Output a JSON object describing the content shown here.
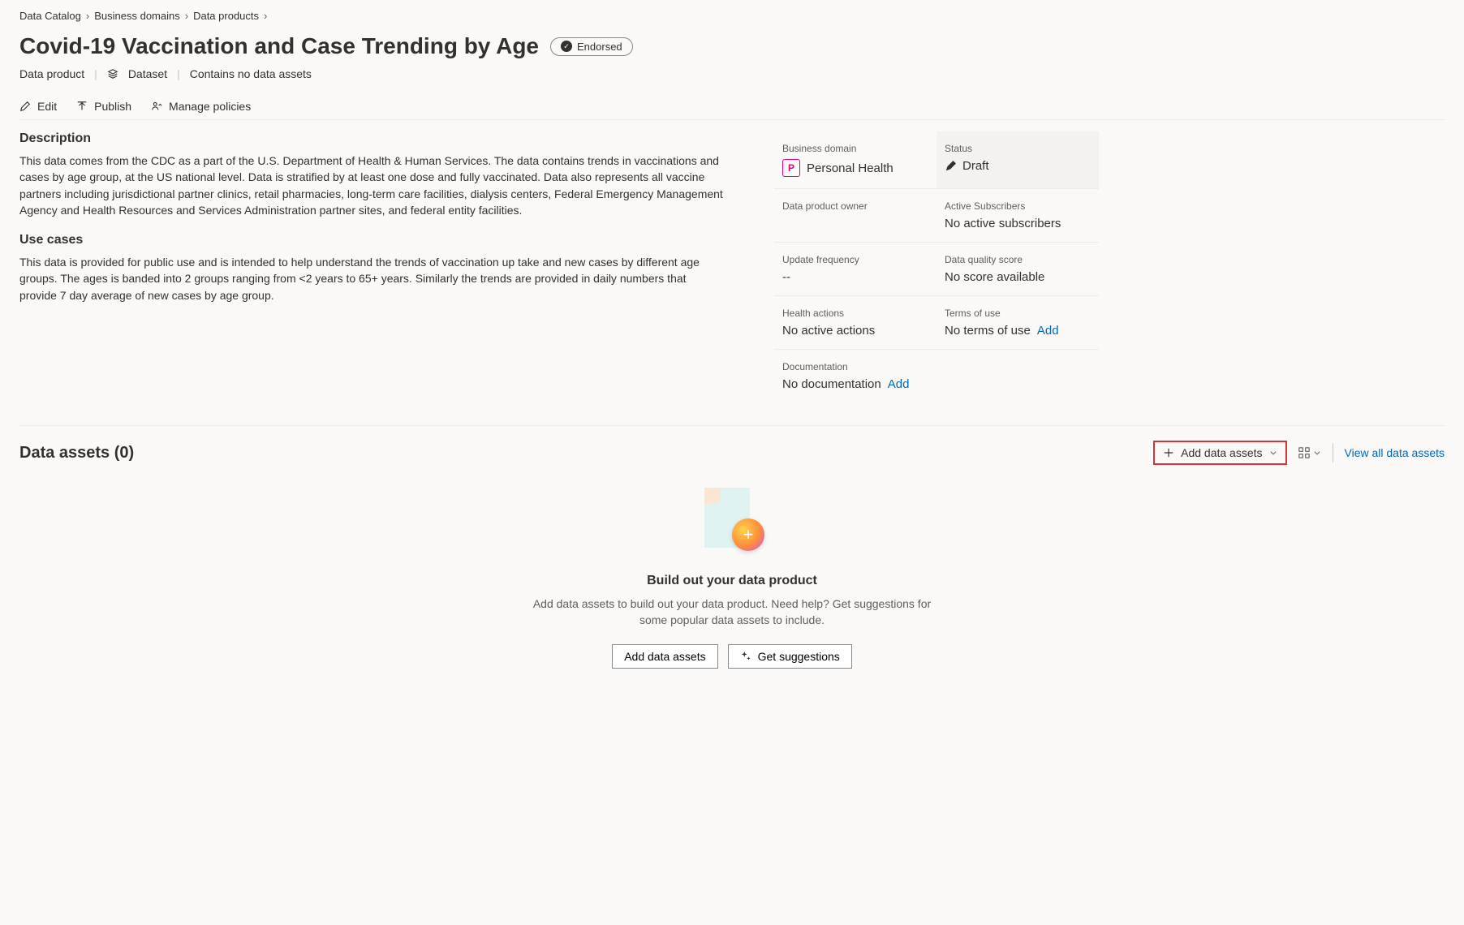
{
  "breadcrumb": [
    "Data Catalog",
    "Business domains",
    "Data products"
  ],
  "title": "Covid-19 Vaccination and Case Trending by Age",
  "endorsed_label": "Endorsed",
  "subheader": {
    "kind": "Data product",
    "type": "Dataset",
    "assets_note": "Contains no data assets"
  },
  "actions": {
    "edit": "Edit",
    "publish": "Publish",
    "manage_policies": "Manage policies"
  },
  "description": {
    "heading": "Description",
    "body": "This data comes from the CDC as a part of the U.S. Department of Health & Human Services.  The data contains trends in vaccinations and cases by age group, at the US national level. Data is stratified by at least one dose and fully vaccinated. Data also represents all vaccine partners including jurisdictional partner clinics, retail pharmacies, long-term care facilities, dialysis centers, Federal Emergency Management Agency and Health Resources and Services Administration partner sites, and federal entity facilities."
  },
  "use_cases": {
    "heading": "Use cases",
    "body": "This data is provided for public use and is intended to help understand the trends of vaccination up take and new cases by different age groups.  The ages is banded into 2 groups ranging from <2 years to 65+ years.  Similarly the trends are provided in daily numbers that provide 7 day average of new cases by age group."
  },
  "meta": {
    "business_domain": {
      "label": "Business domain",
      "value": "Personal Health",
      "tile": "P"
    },
    "status": {
      "label": "Status",
      "value": "Draft"
    },
    "owner": {
      "label": "Data product owner",
      "value": ""
    },
    "subscribers": {
      "label": "Active Subscribers",
      "value": "No active subscribers"
    },
    "update_freq": {
      "label": "Update frequency",
      "value": "--"
    },
    "dq_score": {
      "label": "Data quality score",
      "value": "No score available"
    },
    "health": {
      "label": "Health actions",
      "value": "No active actions"
    },
    "terms": {
      "label": "Terms of use",
      "value": "No terms of use",
      "link": "Add"
    },
    "docs": {
      "label": "Documentation",
      "value": "No documentation",
      "link": "Add"
    }
  },
  "assets": {
    "title": "Data assets (0)",
    "add_btn": "Add data assets",
    "view_all": "View all data assets",
    "empty_title": "Build out your data product",
    "empty_sub": "Add data assets to build out your data product. Need help? Get suggestions for some popular data assets to include.",
    "btn_add": "Add data assets",
    "btn_suggest": "Get suggestions"
  }
}
